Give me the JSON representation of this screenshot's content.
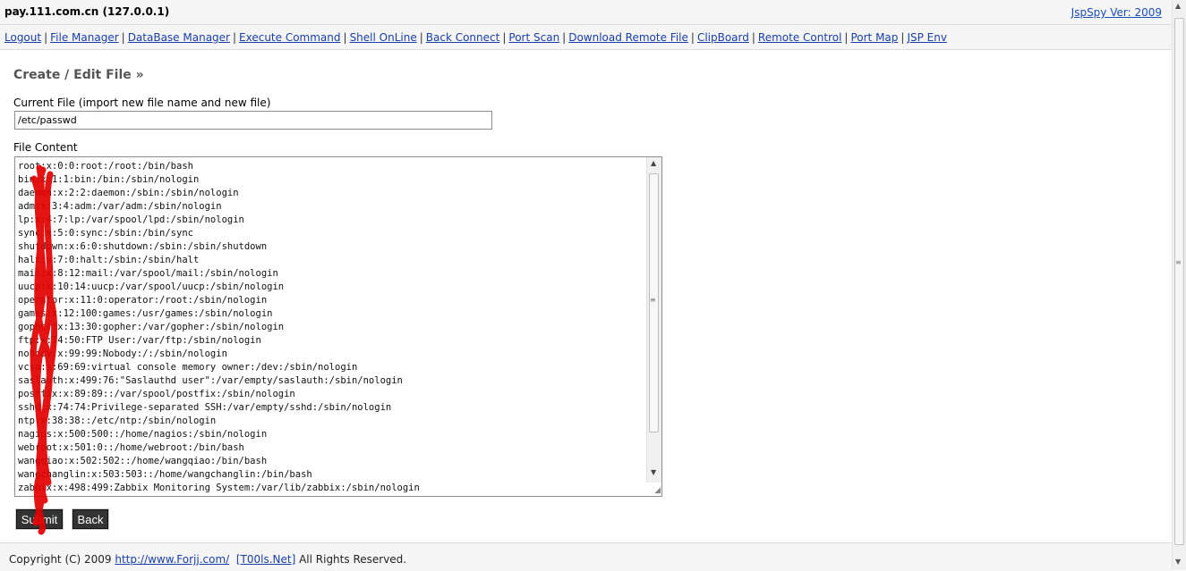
{
  "header": {
    "host": "pay.111.com.cn (127.0.0.1)",
    "version_link": "JspSpy Ver: 2009"
  },
  "nav": {
    "items": [
      "Logout",
      "File Manager",
      "DataBase Manager",
      "Execute Command",
      "Shell OnLine",
      "Back Connect",
      "Port Scan",
      "Download Remote File",
      "ClipBoard",
      "Remote Control",
      "Port Map",
      "JSP Env"
    ]
  },
  "main": {
    "section_title": "Create / Edit File »",
    "current_file_label": "Current File (import new file name and new file)",
    "current_file_value": "/etc/passwd",
    "file_content_label": "File Content",
    "file_content_lines": [
      "root:x:0:0:root:/root:/bin/bash",
      "bin:x:1:1:bin:/bin:/sbin/nologin",
      "daemon:x:2:2:daemon:/sbin:/sbin/nologin",
      "adm:x:3:4:adm:/var/adm:/sbin/nologin",
      "lp:x:4:7:lp:/var/spool/lpd:/sbin/nologin",
      "sync:x:5:0:sync:/sbin:/bin/sync",
      "shutdown:x:6:0:shutdown:/sbin:/sbin/shutdown",
      "halt:x:7:0:halt:/sbin:/sbin/halt",
      "mail:x:8:12:mail:/var/spool/mail:/sbin/nologin",
      "uucp:x:10:14:uucp:/var/spool/uucp:/sbin/nologin",
      "operator:x:11:0:operator:/root:/sbin/nologin",
      "games:x:12:100:games:/usr/games:/sbin/nologin",
      "gopher:x:13:30:gopher:/var/gopher:/sbin/nologin",
      "ftp:x:14:50:FTP User:/var/ftp:/sbin/nologin",
      "nobody:x:99:99:Nobody:/:/sbin/nologin",
      "vcsa:x:69:69:virtual console memory owner:/dev:/sbin/nologin",
      "saslauth:x:499:76:\"Saslauthd user\":/var/empty/saslauth:/sbin/nologin",
      "postfix:x:89:89::/var/spool/postfix:/sbin/nologin",
      "sshd:x:74:74:Privilege-separated SSH:/var/empty/sshd:/sbin/nologin",
      "ntp:x:38:38::/etc/ntp:/sbin/nologin",
      "nagios:x:500:500::/home/nagios:/sbin/nologin",
      "webroot:x:501:0::/home/webroot:/bin/bash",
      "wangqiao:x:502:502::/home/wangqiao:/bin/bash",
      "wangchanglin:x:503:503::/home/wangchanglin:/bin/bash",
      "zabbix:x:498:499:Zabbix Monitoring System:/var/lib/zabbix:/sbin/nologin"
    ],
    "submit_label": "Submit",
    "back_label": "Back"
  },
  "footer": {
    "prefix": "Copyright (C) 2009 ",
    "link1": "http://www.Forjj.com/",
    "link2": "[T00ls.Net]",
    "suffix": " All Rights Reserved."
  },
  "colors": {
    "link": "#1a3fa8",
    "bar_bg": "#f5f5f5",
    "button_bg": "#333333",
    "scribble": "#e30000"
  }
}
